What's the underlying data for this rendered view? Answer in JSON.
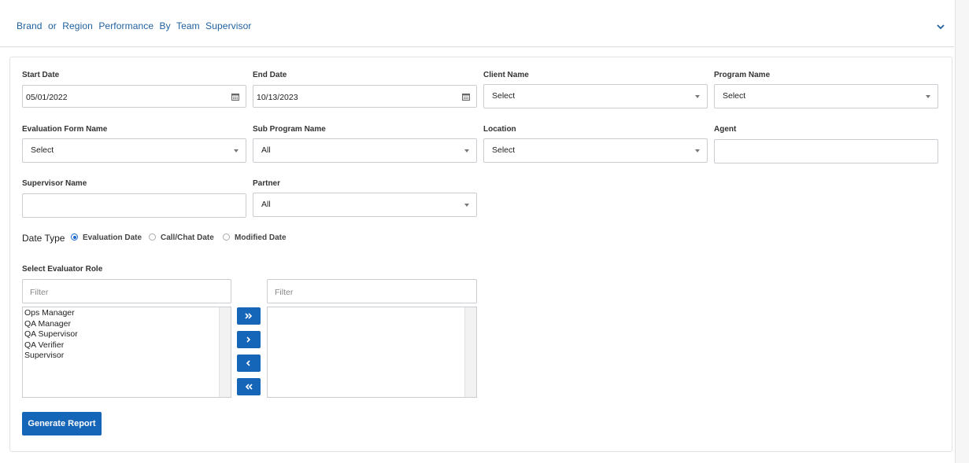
{
  "header": {
    "title": "Brand or Region Performance By Team Supervisor",
    "toggle_icon": "chevron-down-icon"
  },
  "form": {
    "start_date": {
      "label": "Start Date",
      "value": "05/01/2022",
      "icon": "calendar-icon"
    },
    "end_date": {
      "label": "End Date",
      "value": "10/13/2023",
      "icon": "calendar-icon"
    },
    "client_name": {
      "label": "Client Name",
      "value": "Select"
    },
    "program_name": {
      "label": "Program Name",
      "value": "Select"
    },
    "evaluation_form_name": {
      "label": "Evaluation Form Name",
      "value": "Select"
    },
    "sub_program_name": {
      "label": "Sub Program Name",
      "value": "All"
    },
    "location": {
      "label": "Location",
      "value": "Select"
    },
    "agent": {
      "label": "Agent",
      "value": ""
    },
    "supervisor_name": {
      "label": "Supervisor Name",
      "value": ""
    },
    "partner": {
      "label": "Partner",
      "value": "All"
    }
  },
  "date_type": {
    "label": "Date Type",
    "options": [
      {
        "label": "Evaluation Date",
        "selected": true
      },
      {
        "label": "Call/Chat Date",
        "selected": false
      },
      {
        "label": "Modified Date",
        "selected": false
      }
    ]
  },
  "evaluator_role": {
    "label": "Select Evaluator Role",
    "left_filter_placeholder": "Filter",
    "right_filter_placeholder": "Filter",
    "available": [
      "Ops Manager",
      "QA Manager",
      "QA Supervisor",
      "QA Verifier",
      "Supervisor"
    ],
    "selected": [],
    "buttons": [
      "move-all-right-icon",
      "move-right-icon",
      "move-left-icon",
      "move-all-left-icon"
    ]
  },
  "actions": {
    "generate_label": "Generate Report"
  },
  "colors": {
    "primary": "#1565b8",
    "header_text": "#1e5f9e",
    "border": "#c9cdd2"
  }
}
